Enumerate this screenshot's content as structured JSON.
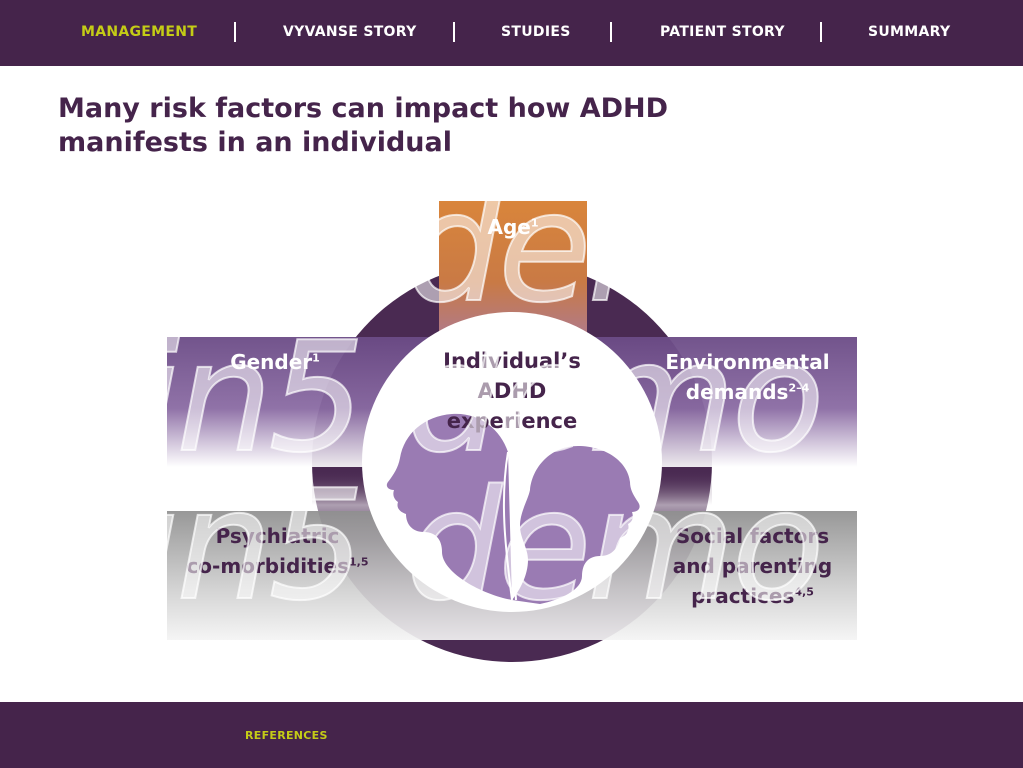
{
  "nav": {
    "items": [
      {
        "label": "MANAGEMENT",
        "active": true
      },
      {
        "label": "VYVANSE STORY",
        "active": false
      },
      {
        "label": "STUDIES",
        "active": false
      },
      {
        "label": "PATIENT STORY",
        "active": false
      },
      {
        "label": "SUMMARY",
        "active": false
      }
    ],
    "separator": "|"
  },
  "page": {
    "title": "Many risk factors can impact how ADHD manifests in an individual"
  },
  "diagram": {
    "age": {
      "label": "Age",
      "ref": "1"
    },
    "gender": {
      "label": "Gender",
      "ref": "1"
    },
    "environmental": {
      "line1": "Environmental",
      "line2": "demands",
      "ref": "2–4"
    },
    "psychiatric": {
      "line1": "Psychiatric",
      "line2": "co-morbidities",
      "ref": "1,5"
    },
    "social": {
      "line1": "Social factors",
      "line2": "and parenting",
      "line3": "practices",
      "ref": "4,5"
    },
    "center": {
      "line1": "Individual’s",
      "line2": "ADHD",
      "line3": "experience"
    }
  },
  "watermark": {
    "text": "in5 demo"
  },
  "footer": {
    "references_label": "REFERENCES"
  },
  "colors": {
    "brand_purple": "#45244b",
    "accent_lime": "#c4cc16",
    "age_orange": "#d9853b",
    "band_purple": "#6b4b86",
    "band_gray": "#9a9a9a",
    "silhouette": "#9a7bb3"
  }
}
